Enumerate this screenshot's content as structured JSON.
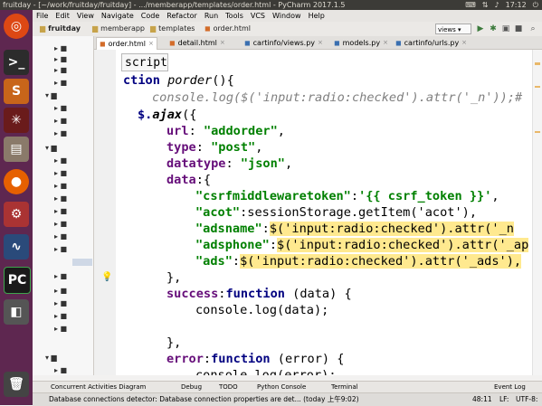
{
  "window_title": "fruitday - [~/work/fruitday/fruitday] - .../memberapp/templates/order.html - PyCharm 2017.1.5",
  "system_clock": "17:12",
  "menu": [
    "File",
    "Edit",
    "View",
    "Navigate",
    "Code",
    "Refactor",
    "Run",
    "Tools",
    "VCS",
    "Window",
    "Help"
  ],
  "breadcrumbs": [
    "fruitday",
    "memberapp",
    "templates",
    "order.html"
  ],
  "run_config": "views",
  "tabs": [
    {
      "label": "order.html",
      "active": true
    },
    {
      "label": "detail.html",
      "active": false
    },
    {
      "label": "cartinfo/views.py",
      "active": false
    },
    {
      "label": "models.py",
      "active": false
    },
    {
      "label": "cartinfo/urls.py",
      "active": false
    }
  ],
  "tooltip": "script",
  "code_lines": {
    "l1_kw": "ction ",
    "l1_fn": "porder",
    "l1_rest": "(){",
    "l2": "console.log($('input:radio:checked').attr('_n'));#",
    "l3_obj": "$.",
    "l3_fn": "ajax",
    "l3_rest": "({",
    "l4_key": "url",
    "l4_val": "\"addorder\"",
    "l5_key": "type",
    "l5_val": "\"post\"",
    "l6_key": "datatype",
    "l6_val": "\"json\"",
    "l7_key": "data",
    "l8_key": "\"csrfmiddlewaretoken\"",
    "l8_val": "'{{ csrf_token }}'",
    "l9_key": "\"acot\"",
    "l9_val": "sessionStorage.getItem('acot'),",
    "l10_key": "\"adsname\"",
    "l10_val": "$('input:radio:checked').attr('_n",
    "l11_key": "\"adsphone\"",
    "l11_val": "$('input:radio:checked').attr('_ap",
    "l12_key": "\"ads\"",
    "l12_val": "$('input:radio:checked').attr('_ads'),",
    "l13": "},",
    "l14_key": "success",
    "l14_kw": "function",
    "l14_arg": "(data) {",
    "l15": "console.log(data);",
    "l16": "},",
    "l17_key": "error",
    "l17_kw": "function",
    "l17_arg": "(error) {",
    "l18": "console.log(error);"
  },
  "bottom_tools": [
    "Concurrent Activities Diagram",
    "Debug",
    "TODO",
    "Python Console",
    "Terminal",
    "Event Log"
  ],
  "status_message": "Database connections detector: Database connection properties are det... (today 上午9:02)",
  "status_position": "48:11",
  "status_lf": "LF:",
  "status_encoding": "UTF-8:"
}
